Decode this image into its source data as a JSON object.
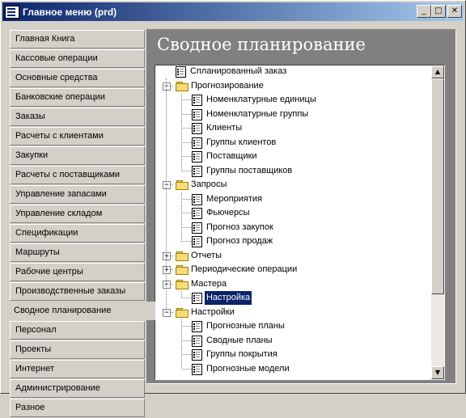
{
  "window": {
    "title": "Главное меню (prd)"
  },
  "title_buttons": {
    "minimize": "_",
    "maximize": "□",
    "close": "✕"
  },
  "nav": {
    "items": [
      {
        "label": "Главная Книга"
      },
      {
        "label": "Кассовые операции"
      },
      {
        "label": "Основные средства"
      },
      {
        "label": "Банковские операции"
      },
      {
        "label": "Заказы"
      },
      {
        "label": "Расчеты с клиентами"
      },
      {
        "label": "Закупки"
      },
      {
        "label": "Расчеты с поставщиками"
      },
      {
        "label": "Управление запасами"
      },
      {
        "label": "Управление складом"
      },
      {
        "label": "Спецификации"
      },
      {
        "label": "Маршруты"
      },
      {
        "label": "Рабочие центры"
      },
      {
        "label": "Производственные заказы"
      },
      {
        "label": "Сводное планирование",
        "active": true
      },
      {
        "label": "Персонал"
      },
      {
        "label": "Проекты"
      },
      {
        "label": "Интернет"
      },
      {
        "label": "Администрирование"
      },
      {
        "label": "Разное"
      }
    ]
  },
  "panel": {
    "title": "Сводное планирование"
  },
  "tree": {
    "rows": [
      {
        "label": "Спланированный заказ",
        "type": "form",
        "level": 1
      },
      {
        "label": "Прогнозирование",
        "type": "folder",
        "level": 0,
        "expander": "−"
      },
      {
        "label": "Номенклатурные единицы",
        "type": "form",
        "level": 2
      },
      {
        "label": "Номенклатурные группы",
        "type": "form",
        "level": 2
      },
      {
        "label": "Клиенты",
        "type": "form",
        "level": 2
      },
      {
        "label": "Группы клиентов",
        "type": "form",
        "level": 2
      },
      {
        "label": "Поставщики",
        "type": "form",
        "level": 2
      },
      {
        "label": "Группы поставщиков",
        "type": "form",
        "level": 2
      },
      {
        "label": "Запросы",
        "type": "folder",
        "level": 0,
        "expander": "−"
      },
      {
        "label": "Мероприятия",
        "type": "form",
        "level": 2
      },
      {
        "label": "Фьючерсы",
        "type": "form",
        "level": 2
      },
      {
        "label": "Прогноз закупок",
        "type": "form",
        "level": 2
      },
      {
        "label": "Прогноз продаж",
        "type": "form",
        "level": 2
      },
      {
        "label": "Отчеты",
        "type": "folder",
        "level": 0,
        "expander": "+"
      },
      {
        "label": "Периодические операции",
        "type": "folder",
        "level": 0,
        "expander": "+"
      },
      {
        "label": "Мастера",
        "type": "folder",
        "level": 0,
        "expander": "−"
      },
      {
        "label": "Настройка",
        "type": "form",
        "level": 2,
        "selected": true
      },
      {
        "label": "Настройки",
        "type": "folder",
        "level": 0,
        "expander": "−"
      },
      {
        "label": "Прогнозные планы",
        "type": "form",
        "level": 2
      },
      {
        "label": "Сводные планы",
        "type": "form",
        "level": 2
      },
      {
        "label": "Группы покрытия",
        "type": "form",
        "level": 2
      },
      {
        "label": "Прогнозные модели",
        "type": "form",
        "level": 2
      }
    ]
  },
  "scrollbar": {
    "up": "▲",
    "down": "▼"
  }
}
